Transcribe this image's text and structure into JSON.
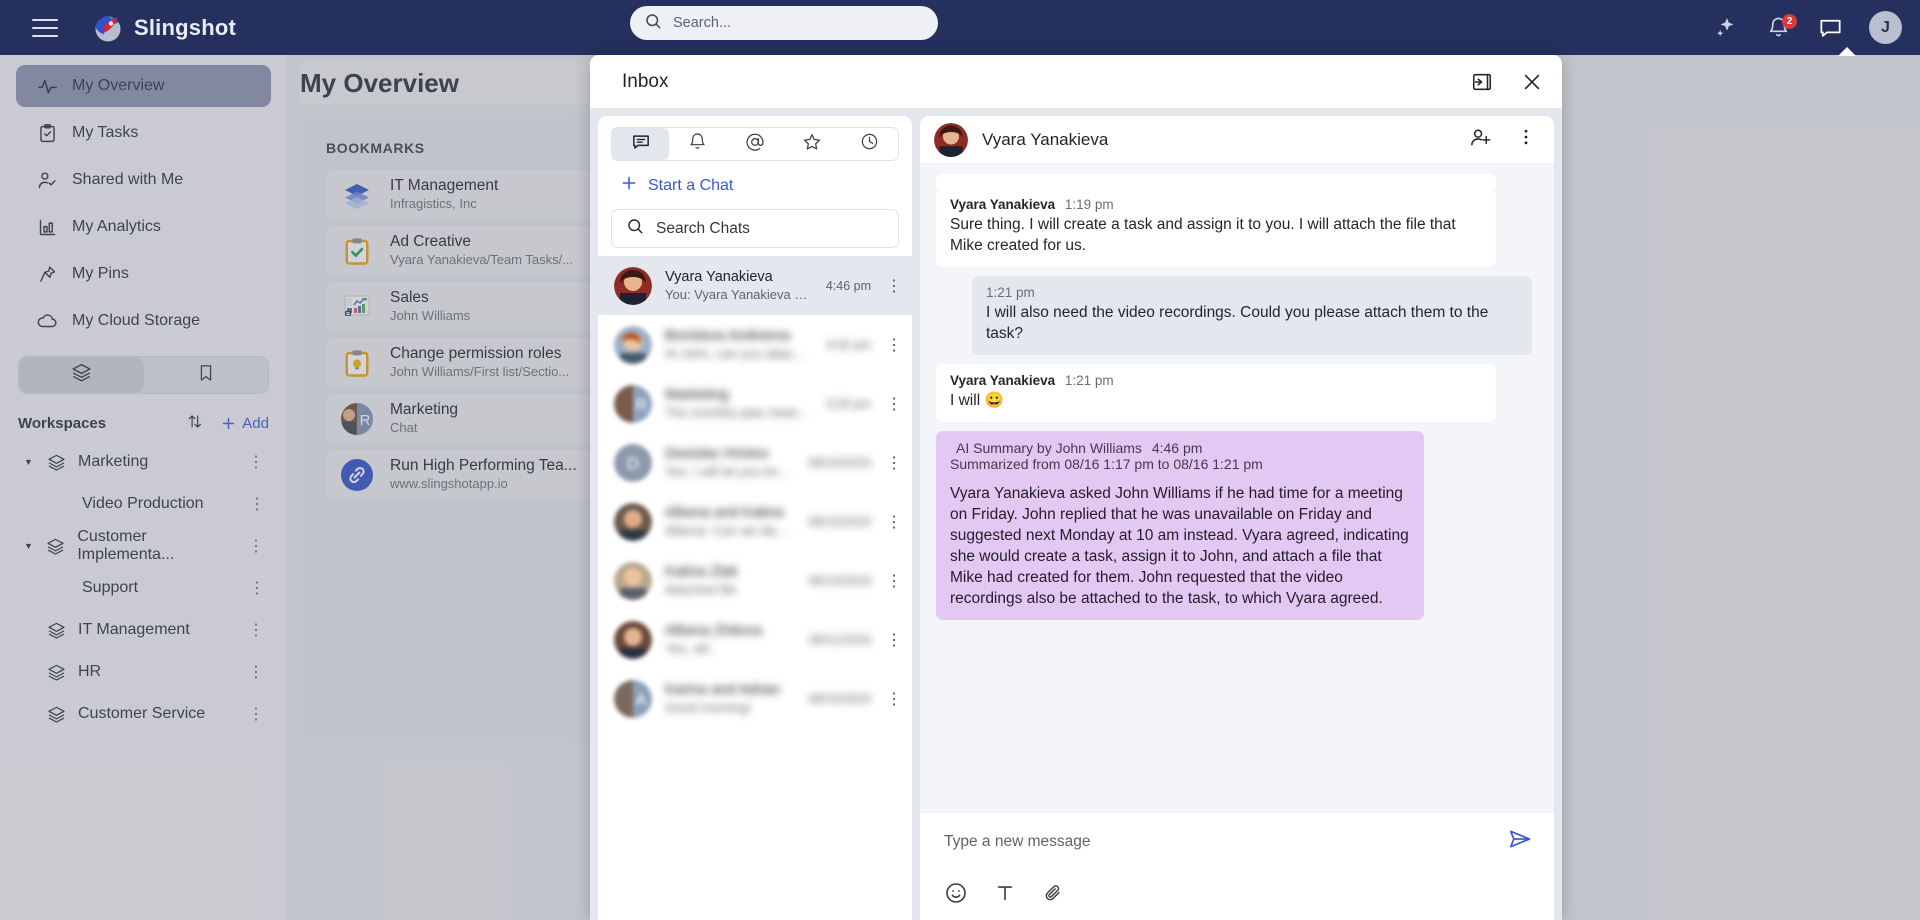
{
  "topbar": {
    "brand": "Slingshot",
    "search_placeholder": "Search...",
    "notifications_badge": "2",
    "avatar_initial": "J"
  },
  "sidebar": {
    "nav": [
      {
        "label": "My Overview",
        "icon": "activity-icon",
        "active": true
      },
      {
        "label": "My Tasks",
        "icon": "clipboard-check-icon",
        "active": false
      },
      {
        "label": "Shared with Me",
        "icon": "user-check-icon",
        "active": false
      },
      {
        "label": "My Analytics",
        "icon": "bar-chart-icon",
        "active": false
      },
      {
        "label": "My Pins",
        "icon": "pin-icon",
        "active": false
      },
      {
        "label": "My Cloud Storage",
        "icon": "cloud-icon",
        "active": false
      }
    ],
    "segment": [
      {
        "icon": "layers-icon",
        "selected": true
      },
      {
        "icon": "bookmark-icon",
        "selected": false
      }
    ],
    "workspaces_title": "Workspaces",
    "sort_icon": "sort-arrows-icon",
    "add_label": "Add",
    "workspaces": [
      {
        "label": "Marketing",
        "expandable": true,
        "child": "Video Production"
      },
      {
        "label": "Customer Implementa...",
        "expandable": true,
        "child": "Support"
      },
      {
        "label": "IT Management",
        "expandable": false,
        "child": null
      },
      {
        "label": "HR",
        "expandable": false,
        "child": null
      },
      {
        "label": "Customer Service",
        "expandable": false,
        "child": null
      }
    ]
  },
  "main": {
    "page_title": "My Overview",
    "bookmarks_header": "BOOKMARKS",
    "bookmarks": [
      {
        "title": "IT Management",
        "subtitle": "Infragistics, Inc",
        "icon": "layers-blue-icon"
      },
      {
        "title": "Ad Creative",
        "subtitle": "Vyara Yanakieva/Team Tasks/...",
        "icon": "task-check-icon"
      },
      {
        "title": "Sales",
        "subtitle": "John Williams",
        "icon": "dashboard-icon"
      },
      {
        "title": "Change permission roles",
        "subtitle": "John Williams/First list/Sectio...",
        "icon": "task-idea-icon"
      },
      {
        "title": "Marketing",
        "subtitle": "Chat",
        "icon": "chat-avatars-icon"
      },
      {
        "title": "Run High Performing Tea...",
        "subtitle": "www.slingshotapp.io",
        "icon": "link-icon"
      }
    ]
  },
  "inbox": {
    "title": "Inbox",
    "collapse_icon": "collapse-panel-icon",
    "close_icon": "close-icon",
    "tabs": [
      {
        "name": "chats-tab",
        "icon": "chat-bubble-icon",
        "selected": true
      },
      {
        "name": "notifications-tab",
        "icon": "bell-icon",
        "selected": false
      },
      {
        "name": "mentions-tab",
        "icon": "at-icon",
        "selected": false
      },
      {
        "name": "starred-tab",
        "icon": "star-icon",
        "selected": false
      },
      {
        "name": "recent-tab",
        "icon": "clock-icon",
        "selected": false
      }
    ],
    "start_chat_label": "Start a Chat",
    "search_placeholder": "Search Chats",
    "chats": [
      {
        "name": "Vyara Yanakieva",
        "preview": "You: Vyara Yanakieva as...",
        "time": "4:46 pm",
        "selected": true,
        "blurred": false
      },
      {
        "name": "Borislava Andreeva",
        "preview": "Hi John, can you attach the...",
        "time": "4:02 pm",
        "selected": false,
        "blurred": true
      },
      {
        "name": "Marketing",
        "preview": "The monthly plan meeting...",
        "time": "3:20 pm",
        "selected": false,
        "blurred": true
      },
      {
        "name": "Desislav Hristov",
        "preview": "Yes, I will let you know...",
        "time": "08/15/2023",
        "selected": false,
        "blurred": true
      },
      {
        "name": "Albena and Katina",
        "preview": "Albena: Can we discuss...",
        "time": "08/15/2023",
        "selected": false,
        "blurred": true
      },
      {
        "name": "Katina Zlati",
        "preview": "Attached file",
        "time": "08/14/2023",
        "selected": false,
        "blurred": true
      },
      {
        "name": "Albena Zhitova",
        "preview": "Yes, ok!",
        "time": "08/11/2023",
        "selected": false,
        "blurred": true
      },
      {
        "name": "Karina and Adrian",
        "preview": "Good morning!",
        "time": "08/10/2023",
        "selected": false,
        "blurred": true
      }
    ],
    "conversation": {
      "contact": "Vyara Yanakieva",
      "add_person_icon": "add-person-icon",
      "more_icon": "more-vertical-icon",
      "messages": [
        {
          "type": "them",
          "author": "Vyara Yanakieva",
          "time": "1:19 pm",
          "text": "Sure thing. I will create a task and assign it to you. I will attach the file that Mike created for us."
        },
        {
          "type": "me",
          "author": "",
          "time": "1:21 pm",
          "text": "I will also need the video recordings. Could you please attach them to the task?"
        },
        {
          "type": "them",
          "author": "Vyara Yanakieva",
          "time": "1:21 pm",
          "text": "I will 😀"
        }
      ],
      "summary": {
        "heading": "AI Summary by John Williams",
        "time": "4:46 pm",
        "range": "Summarized from 08/16 1:17 pm to 08/16 1:21 pm",
        "body": "Vyara Yanakieva asked John Williams if he had time for a meeting on Friday. John replied that he was unavailable on Friday and suggested next Monday at 10 am instead. Vyara agreed, indicating she would create a task, assign it to John, and attach a file that Mike had created for them. John requested that the video recordings also be attached to the task, to which Vyara agreed."
      },
      "composer": {
        "placeholder": "Type a new message",
        "send_icon": "send-icon",
        "tools": [
          {
            "name": "emoji-icon"
          },
          {
            "name": "text-format-icon"
          },
          {
            "name": "attachment-icon"
          }
        ]
      }
    }
  },
  "colors": {
    "topbar": "#25305e",
    "accent": "#3a57d8",
    "summary_bg": "#e2c8f2",
    "badge": "#d93a3a"
  }
}
